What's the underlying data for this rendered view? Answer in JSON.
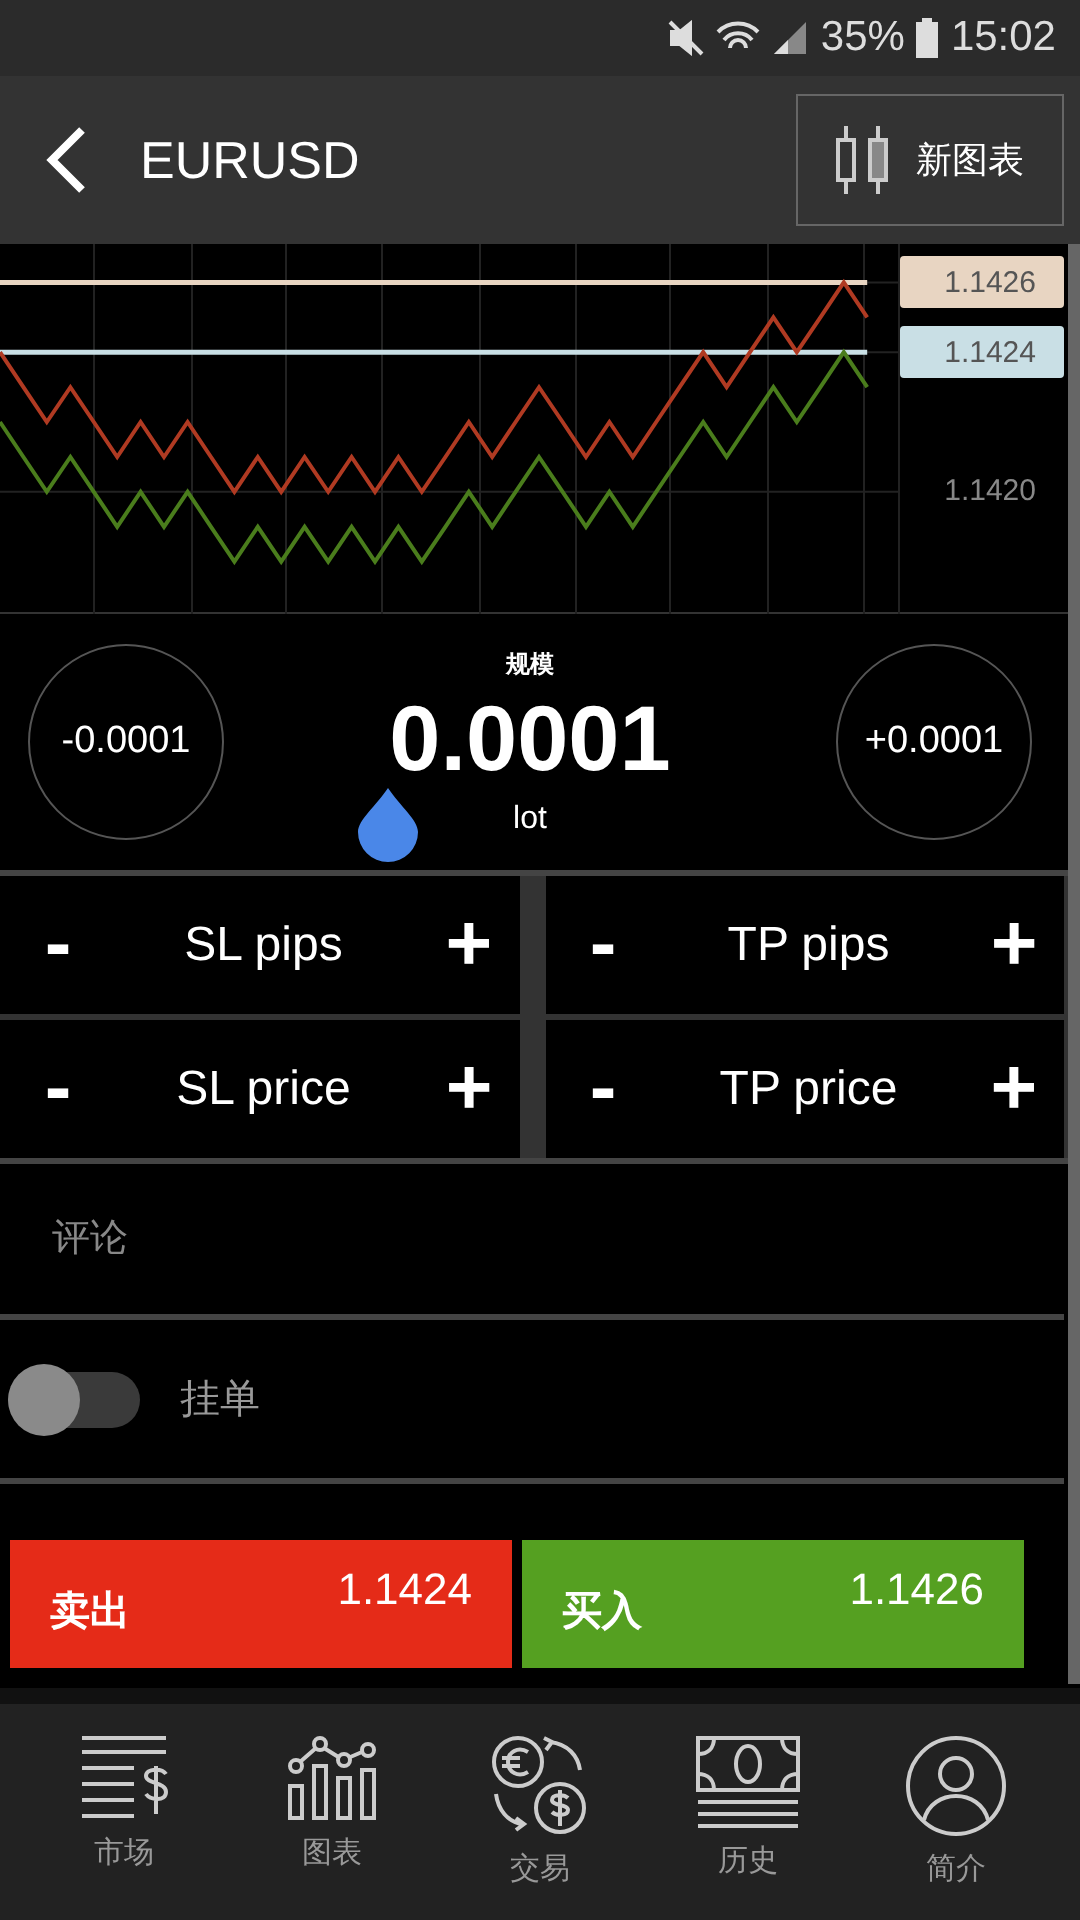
{
  "status_bar": {
    "battery": "35%",
    "time": "15:02"
  },
  "header": {
    "title": "EURUSD",
    "new_chart_button": "新图表"
  },
  "chart": {
    "chart_data": {
      "type": "line",
      "categories": [
        null,
        null,
        null,
        null,
        null,
        null,
        null,
        null,
        null,
        null,
        null,
        null,
        null,
        null,
        null,
        null,
        null,
        null,
        null,
        null,
        null,
        null,
        null,
        null,
        null,
        null,
        null,
        null,
        null,
        null,
        null,
        null,
        null,
        null,
        null,
        null,
        null,
        null
      ],
      "ylim": [
        1.14165,
        1.14271
      ],
      "grid": true,
      "series": [
        {
          "color": "#e8d5c2",
          "values": [
            1.1426,
            1.1426,
            1.1426,
            1.1426,
            1.1426,
            1.1426,
            1.1426,
            1.1426,
            1.1426,
            1.1426,
            1.1426,
            1.1426,
            1.1426,
            1.1426,
            1.1426,
            1.1426,
            1.1426,
            1.1426,
            1.1426,
            1.1426,
            1.1426,
            1.1426,
            1.1426,
            1.1426,
            1.1426,
            1.1426,
            1.1426,
            1.1426,
            1.1426,
            1.1426,
            1.1426,
            1.1426,
            1.1426,
            1.1426,
            1.1426,
            1.1426,
            1.1426,
            1.1426
          ]
        },
        {
          "color": "#c9dfe5",
          "values": [
            1.1424,
            1.1424,
            1.1424,
            1.1424,
            1.1424,
            1.1424,
            1.1424,
            1.1424,
            1.1424,
            1.1424,
            1.1424,
            1.1424,
            1.1424,
            1.1424,
            1.1424,
            1.1424,
            1.1424,
            1.1424,
            1.1424,
            1.1424,
            1.1424,
            1.1424,
            1.1424,
            1.1424,
            1.1424,
            1.1424,
            1.1424,
            1.1424,
            1.1424,
            1.1424,
            1.1424,
            1.1424,
            1.1424,
            1.1424,
            1.1424,
            1.1424,
            1.1424,
            1.1424
          ]
        },
        {
          "color": "#b03a22",
          "values": [
            1.1424,
            1.1423,
            1.1422,
            1.1423,
            1.1422,
            1.1421,
            1.1422,
            1.1421,
            1.1422,
            1.1421,
            1.142,
            1.1421,
            1.142,
            1.1421,
            1.142,
            1.1421,
            1.142,
            1.1421,
            1.142,
            1.1421,
            1.1422,
            1.1421,
            1.1422,
            1.1423,
            1.1422,
            1.1421,
            1.1422,
            1.1421,
            1.1422,
            1.1423,
            1.1424,
            1.1423,
            1.1424,
            1.1425,
            1.1424,
            1.1425,
            1.1426,
            1.1425
          ]
        },
        {
          "color": "#4a7d1c",
          "values": [
            1.1422,
            1.1421,
            1.142,
            1.1421,
            1.142,
            1.1419,
            1.142,
            1.1419,
            1.142,
            1.1419,
            1.1418,
            1.1419,
            1.1418,
            1.1419,
            1.1418,
            1.1419,
            1.1418,
            1.1419,
            1.1418,
            1.1419,
            1.142,
            1.1419,
            1.142,
            1.1421,
            1.142,
            1.1419,
            1.142,
            1.1419,
            1.142,
            1.1421,
            1.1422,
            1.1421,
            1.1422,
            1.1423,
            1.1422,
            1.1423,
            1.1424,
            1.1423
          ]
        }
      ],
      "yticks": [
        {
          "value": 1.142,
          "label": "1.1420"
        },
        {
          "value": 1.1424,
          "label": "1.1424"
        },
        {
          "value": 1.1426,
          "label": "1.1426"
        }
      ]
    }
  },
  "lot": {
    "caption": "规模",
    "value": "0.0001",
    "unit": "lot",
    "decrease": "-0.0001",
    "increase": "+0.0001"
  },
  "steppers": [
    {
      "minus": "-",
      "label": "SL pips",
      "plus": "+"
    },
    {
      "minus": "-",
      "label": "TP pips",
      "plus": "+"
    },
    {
      "minus": "-",
      "label": "SL price",
      "plus": "+"
    },
    {
      "minus": "-",
      "label": "TP price",
      "plus": "+"
    }
  ],
  "comment": {
    "placeholder": "评论"
  },
  "pending_order": {
    "label": "挂单",
    "on": false
  },
  "actions": [
    {
      "kind": "sell",
      "label": "卖出",
      "price": "1.1424"
    },
    {
      "kind": "buy",
      "label": "买入",
      "price": "1.1426"
    }
  ],
  "nav": [
    {
      "kind": "market",
      "label": "市场"
    },
    {
      "kind": "chart",
      "label": "图表"
    },
    {
      "kind": "trade",
      "label": "交易"
    },
    {
      "kind": "history",
      "label": "历史"
    },
    {
      "kind": "profile",
      "label": "简介"
    }
  ]
}
